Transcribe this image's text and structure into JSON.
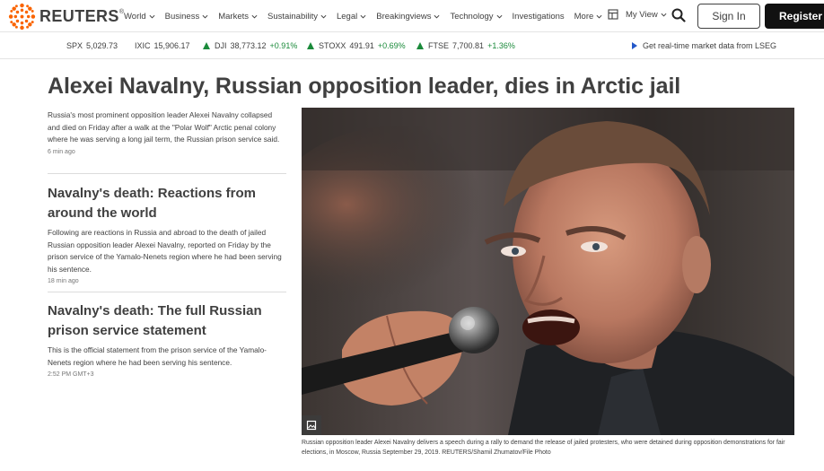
{
  "brand": {
    "name": "REUTERS",
    "mark": "®",
    "logo_color": "#fa6400"
  },
  "nav": {
    "items": [
      {
        "label": "World",
        "icon": "chevron-down-icon"
      },
      {
        "label": "Business",
        "icon": "chevron-down-icon"
      },
      {
        "label": "Markets",
        "icon": "chevron-down-icon"
      },
      {
        "label": "Sustainability",
        "icon": "chevron-down-icon"
      },
      {
        "label": "Legal",
        "icon": "chevron-down-icon"
      },
      {
        "label": "Breakingviews",
        "icon": "chevron-down-icon"
      },
      {
        "label": "Technology",
        "icon": "chevron-down-icon"
      },
      {
        "label": "Investigations",
        "icon": ""
      },
      {
        "label": "More",
        "icon": "chevron-down-icon"
      }
    ],
    "my_view": "My View",
    "search_icon": "search-icon",
    "sign_in": "Sign In",
    "register": "Register"
  },
  "ticker": {
    "items": [
      {
        "symbol": "SPX",
        "value": "5,029.73",
        "change": ""
      },
      {
        "symbol": "IXIC",
        "value": "15,906.17",
        "change": ""
      },
      {
        "symbol": "DJI",
        "value": "38,773.12",
        "change": "+0.91%"
      },
      {
        "symbol": "STOXX",
        "value": "491.91",
        "change": "+0.69%"
      },
      {
        "symbol": "FTSE",
        "value": "7,700.81",
        "change": "+1.36%"
      }
    ],
    "up_color": "#1a8a3a",
    "lseg_link": "Get real-time market data from LSEG"
  },
  "main": {
    "headline": "Alexei Navalny, Russian opposition leader, dies in Arctic jail",
    "lead": {
      "summary": "Russia's most prominent opposition leader Alexei Navalny collapsed and died on Friday after a walk at the \"Polar Wolf\" Arctic penal colony where he was serving a long jail term, the Russian prison service said.",
      "time": "6 min ago"
    },
    "stories": [
      {
        "title": "Navalny's death: Reactions from around the world",
        "summary": "Following are reactions in Russia and abroad to the death of jailed Russian opposition leader Alexei Navalny, reported on Friday by the prison service of the Yamalo-Nenets region where he had been serving his sentence.",
        "time": "18 min ago"
      },
      {
        "title": "Navalny's death: The full Russian prison service statement",
        "summary": "This is the official statement from the prison service of the Yamalo-Nenets region where he had been serving his sentence.",
        "time": "2:52 PM GMT+3"
      }
    ],
    "photo": {
      "expand_icon": "expand-image-icon",
      "caption": "Russian opposition leader Alexei Navalny delivers a speech during a rally to demand the release of jailed protesters, who were detained during opposition demonstrations for fair elections, in Moscow, Russia September 29, 2019. REUTERS/Shamil Zhumatov/File Photo"
    }
  }
}
